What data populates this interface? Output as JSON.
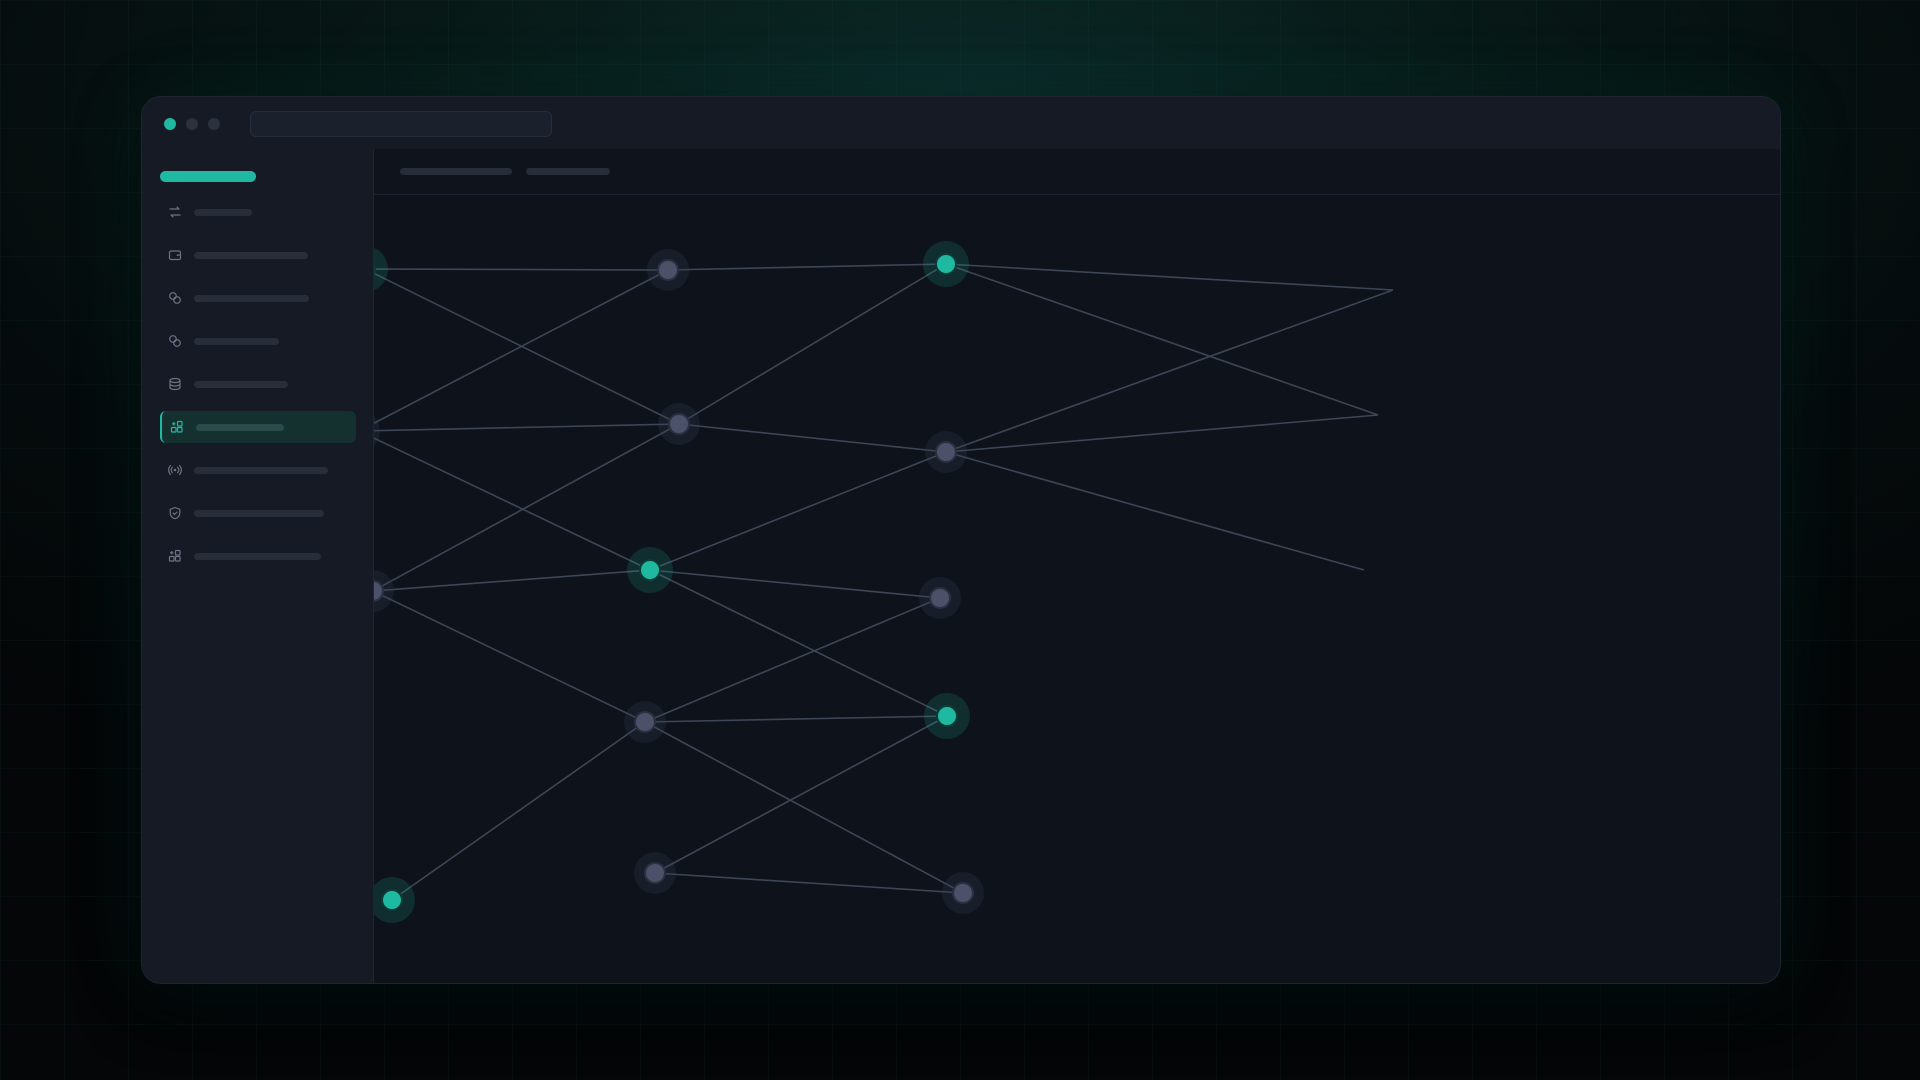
{
  "colors": {
    "accent": "#1fb9a1",
    "node_inactive": "#4a5168",
    "edge": "#3d4656",
    "label_placeholder": "#272e3a"
  },
  "window": {
    "traffic_lights": [
      "#1fb9a1",
      "#2b313d",
      "#2b313d"
    ],
    "address_text": ""
  },
  "sidebar": {
    "brand_label": "",
    "items": [
      {
        "icon": "transfer-arrows-icon",
        "label": "",
        "active": false
      },
      {
        "icon": "wallet-icon",
        "label": "",
        "active": false
      },
      {
        "icon": "coins-icon",
        "label": "",
        "active": false
      },
      {
        "icon": "coins-icon",
        "label": "",
        "active": false
      },
      {
        "icon": "database-icon",
        "label": "",
        "active": false
      },
      {
        "icon": "widgets-icon",
        "label": "",
        "active": true
      },
      {
        "icon": "broadcast-icon",
        "label": "",
        "active": false
      },
      {
        "icon": "shield-icon",
        "label": "",
        "active": false
      },
      {
        "icon": "widgets-icon",
        "label": "",
        "active": false
      }
    ]
  },
  "header": {
    "tabs": [
      {
        "label": ""
      },
      {
        "label": ""
      }
    ]
  },
  "graph": {
    "nodes": [
      {
        "id": "n1",
        "active": true
      },
      {
        "id": "n2",
        "active": false
      },
      {
        "id": "n3",
        "active": true
      },
      {
        "id": "n4",
        "active": false
      },
      {
        "id": "n5",
        "active": false
      },
      {
        "id": "n6",
        "active": false
      },
      {
        "id": "n7",
        "active": false
      },
      {
        "id": "n8",
        "active": true
      },
      {
        "id": "n9",
        "active": false
      },
      {
        "id": "n10",
        "active": false
      },
      {
        "id": "n11",
        "active": true
      },
      {
        "id": "n12",
        "active": true
      },
      {
        "id": "n13",
        "active": false
      },
      {
        "id": "n14",
        "active": false
      }
    ],
    "edges": [
      [
        "n1",
        "n2"
      ],
      [
        "n2",
        "n3"
      ],
      [
        "n1",
        "n5"
      ],
      [
        "n2",
        "n4"
      ],
      [
        "n3",
        "n5"
      ],
      [
        "n3",
        "e1"
      ],
      [
        "n3",
        "e2"
      ],
      [
        "n4",
        "n5"
      ],
      [
        "n5",
        "n6"
      ],
      [
        "n4",
        "n8"
      ],
      [
        "n5",
        "n7"
      ],
      [
        "n6",
        "e1"
      ],
      [
        "n6",
        "e2"
      ],
      [
        "n6",
        "e3"
      ],
      [
        "n7",
        "n8"
      ],
      [
        "n8",
        "n6"
      ],
      [
        "n8",
        "n9"
      ],
      [
        "n8",
        "n11"
      ],
      [
        "n7",
        "n10"
      ],
      [
        "n10",
        "n9"
      ],
      [
        "n10",
        "n11"
      ],
      [
        "n10",
        "n14"
      ],
      [
        "n10",
        "n12"
      ],
      [
        "n11",
        "n13"
      ],
      [
        "n13",
        "n14"
      ]
    ]
  }
}
